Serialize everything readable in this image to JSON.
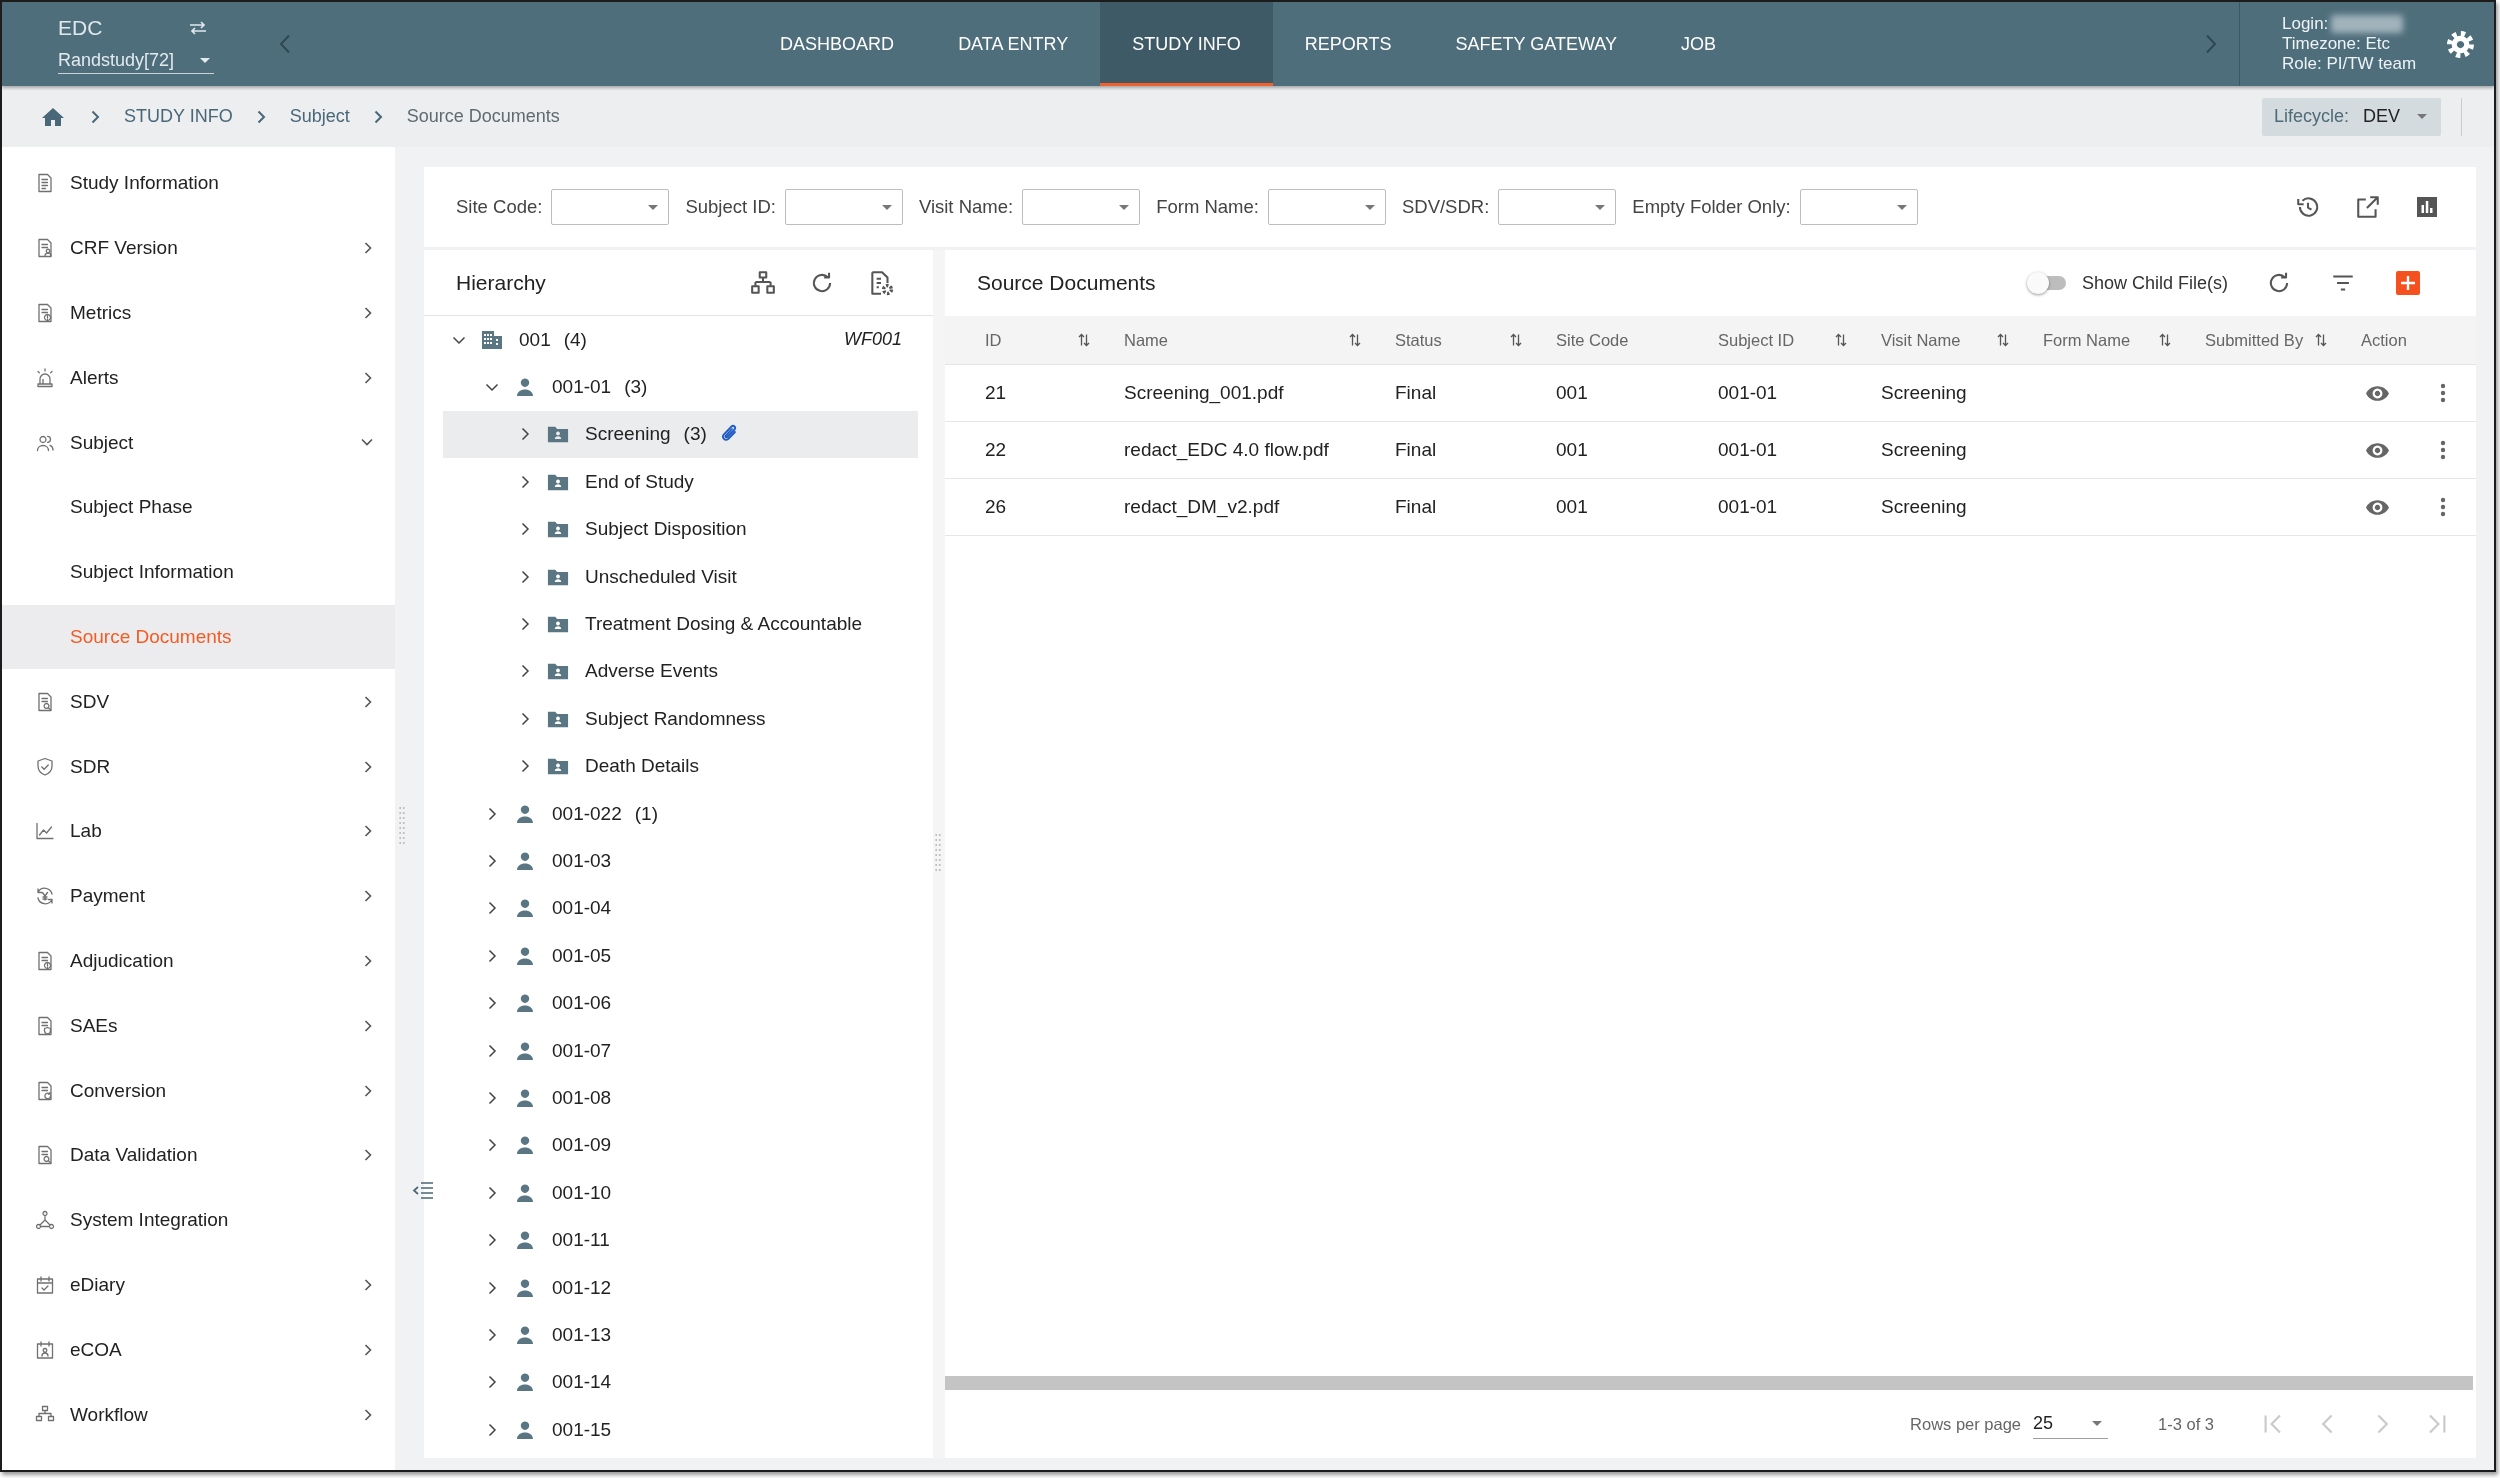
{
  "header": {
    "brand": "EDC",
    "study": "Randstudy[72]"
  },
  "nav_tabs": [
    {
      "label": "DASHBOARD",
      "selected": false
    },
    {
      "label": "DATA ENTRY",
      "selected": false
    },
    {
      "label": "STUDY INFO",
      "selected": true
    },
    {
      "label": "REPORTS",
      "selected": false
    },
    {
      "label": "SAFETY GATEWAY",
      "selected": false
    },
    {
      "label": "JOB",
      "selected": false
    }
  ],
  "user_info": {
    "login": "Login:",
    "timezone": "Timezone: Etc",
    "role": "Role: PI/TW team"
  },
  "breadcrumb": [
    {
      "label": "STUDY INFO",
      "current": false
    },
    {
      "label": "Subject",
      "current": false
    },
    {
      "label": "Source Documents",
      "current": true
    }
  ],
  "lifecycle": {
    "label": "Lifecycle:",
    "value": "DEV"
  },
  "sidebar": {
    "items": [
      {
        "label": "Study Information",
        "kind": "link",
        "selected": false
      },
      {
        "label": "CRF Version",
        "kind": "group",
        "expanded": false,
        "selected": false
      },
      {
        "label": "Metrics",
        "kind": "group",
        "expanded": false,
        "selected": false
      },
      {
        "label": "Alerts",
        "kind": "group",
        "expanded": false,
        "selected": false
      },
      {
        "label": "Subject",
        "kind": "group",
        "expanded": true,
        "selected": false,
        "children": [
          {
            "label": "Subject Phase",
            "selected": false
          },
          {
            "label": "Subject Information",
            "selected": false
          },
          {
            "label": "Source Documents",
            "selected": true
          }
        ]
      },
      {
        "label": "SDV",
        "kind": "group",
        "expanded": false,
        "selected": false
      },
      {
        "label": "SDR",
        "kind": "group",
        "expanded": false,
        "selected": false
      },
      {
        "label": "Lab",
        "kind": "group",
        "expanded": false,
        "selected": false
      },
      {
        "label": "Payment",
        "kind": "group",
        "expanded": false,
        "selected": false
      },
      {
        "label": "Adjudication",
        "kind": "group",
        "expanded": false,
        "selected": false
      },
      {
        "label": "SAEs",
        "kind": "group",
        "expanded": false,
        "selected": false
      },
      {
        "label": "Conversion",
        "kind": "group",
        "expanded": false,
        "selected": false
      },
      {
        "label": "Data Validation",
        "kind": "group",
        "expanded": false,
        "selected": false
      },
      {
        "label": "System Integration",
        "kind": "link",
        "selected": false
      },
      {
        "label": "eDiary",
        "kind": "group",
        "expanded": false,
        "selected": false
      },
      {
        "label": "eCOA",
        "kind": "group",
        "expanded": false,
        "selected": false
      },
      {
        "label": "Workflow",
        "kind": "group",
        "expanded": false,
        "selected": false
      }
    ]
  },
  "filters": [
    {
      "label": "Site Code:"
    },
    {
      "label": "Subject ID:"
    },
    {
      "label": "Visit Name:"
    },
    {
      "label": "Form Name:"
    },
    {
      "label": "SDV/SDR:"
    },
    {
      "label": "Empty Folder Only:"
    }
  ],
  "hierarchy": {
    "title": "Hierarchy",
    "tree": [
      {
        "kind": "site",
        "label": "001",
        "count": "(4)",
        "tag": "WF001",
        "expanded": true,
        "selected": false,
        "children": [
          {
            "kind": "subject",
            "label": "001-01",
            "count": "(3)",
            "expanded": true,
            "selected": false,
            "children": [
              {
                "kind": "visit",
                "label": "Screening",
                "count": "(3)",
                "attachment": true,
                "expanded": false,
                "selected": true
              },
              {
                "kind": "visit",
                "label": "End of Study",
                "attachment": false,
                "expanded": false,
                "selected": false
              },
              {
                "kind": "visit",
                "label": "Subject Disposition",
                "attachment": false,
                "expanded": false,
                "selected": false
              },
              {
                "kind": "visit",
                "label": "Unscheduled Visit",
                "attachment": false,
                "expanded": false,
                "selected": false
              },
              {
                "kind": "visit",
                "label": "Treatment Dosing & Accountable",
                "attachment": false,
                "expanded": false,
                "selected": false
              },
              {
                "kind": "visit",
                "label": "Adverse Events",
                "attachment": false,
                "expanded": false,
                "selected": false
              },
              {
                "kind": "visit",
                "label": "Subject Randomness",
                "attachment": false,
                "expanded": false,
                "selected": false
              },
              {
                "kind": "visit",
                "label": "Death Details",
                "attachment": false,
                "expanded": false,
                "selected": false
              }
            ]
          },
          {
            "kind": "subject",
            "label": "001-022",
            "count": "(1)",
            "expanded": false,
            "selected": false
          },
          {
            "kind": "subject",
            "label": "001-03",
            "expanded": false,
            "selected": false
          },
          {
            "kind": "subject",
            "label": "001-04",
            "expanded": false,
            "selected": false
          },
          {
            "kind": "subject",
            "label": "001-05",
            "expanded": false,
            "selected": false
          },
          {
            "kind": "subject",
            "label": "001-06",
            "expanded": false,
            "selected": false
          },
          {
            "kind": "subject",
            "label": "001-07",
            "expanded": false,
            "selected": false
          },
          {
            "kind": "subject",
            "label": "001-08",
            "expanded": false,
            "selected": false
          },
          {
            "kind": "subject",
            "label": "001-09",
            "expanded": false,
            "selected": false
          },
          {
            "kind": "subject",
            "label": "001-10",
            "expanded": false,
            "selected": false
          },
          {
            "kind": "subject",
            "label": "001-11",
            "expanded": false,
            "selected": false
          },
          {
            "kind": "subject",
            "label": "001-12",
            "expanded": false,
            "selected": false
          },
          {
            "kind": "subject",
            "label": "001-13",
            "expanded": false,
            "selected": false
          },
          {
            "kind": "subject",
            "label": "001-14",
            "expanded": false,
            "selected": false
          },
          {
            "kind": "subject",
            "label": "001-15",
            "expanded": false,
            "selected": false
          }
        ]
      }
    ]
  },
  "documents": {
    "title": "Source Documents",
    "show_child_files": {
      "label": "Show Child File(s)",
      "on": false
    },
    "columns": [
      {
        "label": "ID",
        "sortable": true
      },
      {
        "label": "Name",
        "sortable": true
      },
      {
        "label": "Status",
        "sortable": true
      },
      {
        "label": "Site Code",
        "sortable": false
      },
      {
        "label": "Subject ID",
        "sortable": true
      },
      {
        "label": "Visit Name",
        "sortable": true
      },
      {
        "label": "Form Name",
        "sortable": true
      },
      {
        "label": "Submitted By",
        "sortable": true
      },
      {
        "label": "Action",
        "sortable": false
      }
    ],
    "rows": [
      {
        "id": "21",
        "name": "Screening_001.pdf",
        "status": "Final",
        "site_code": "001",
        "subject_id": "001-01",
        "visit_name": "Screening"
      },
      {
        "id": "22",
        "name": "redact_EDC 4.0 flow.pdf",
        "status": "Final",
        "site_code": "001",
        "subject_id": "001-01",
        "visit_name": "Screening"
      },
      {
        "id": "26",
        "name": "redact_DM_v2.pdf",
        "status": "Final",
        "site_code": "001",
        "subject_id": "001-01",
        "visit_name": "Screening"
      }
    ],
    "pager": {
      "rows_per_page_label": "Rows per page",
      "rows_per_page": "25",
      "range": "1-3 of 3",
      "buttons": [
        {
          "kind": "first",
          "disabled": true
        },
        {
          "kind": "previous",
          "disabled": true
        },
        {
          "kind": "next",
          "disabled": true
        },
        {
          "kind": "last",
          "disabled": true
        }
      ]
    }
  }
}
